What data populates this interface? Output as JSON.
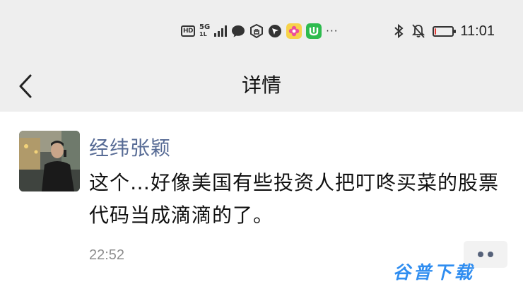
{
  "status_bar": {
    "hd_label": "HD",
    "network_label": "5G",
    "network_sub": "1L",
    "more": "···",
    "time": "11:01",
    "battery_level": 0.08,
    "icons": [
      "hd-icon",
      "5g-signal-icon",
      "chat-bubble-icon",
      "shield-icon",
      "location-icon",
      "flower-app-icon",
      "green-app-icon",
      "bluetooth-icon",
      "mute-icon",
      "battery-icon"
    ]
  },
  "nav": {
    "title": "详情",
    "back_icon": "chevron-left-icon"
  },
  "message": {
    "sender": "经纬张颖",
    "content": "这个…好像美国有些投资人把叮咚买菜的股票代码当成滴滴的了。",
    "time": "22:52",
    "more_icon": "more-dots-icon"
  },
  "watermark": "谷普下载",
  "colors": {
    "header_bg": "#eeeeee",
    "sender_name": "#576b95",
    "battery_low": "#e53935",
    "watermark": "#2f8df0"
  }
}
